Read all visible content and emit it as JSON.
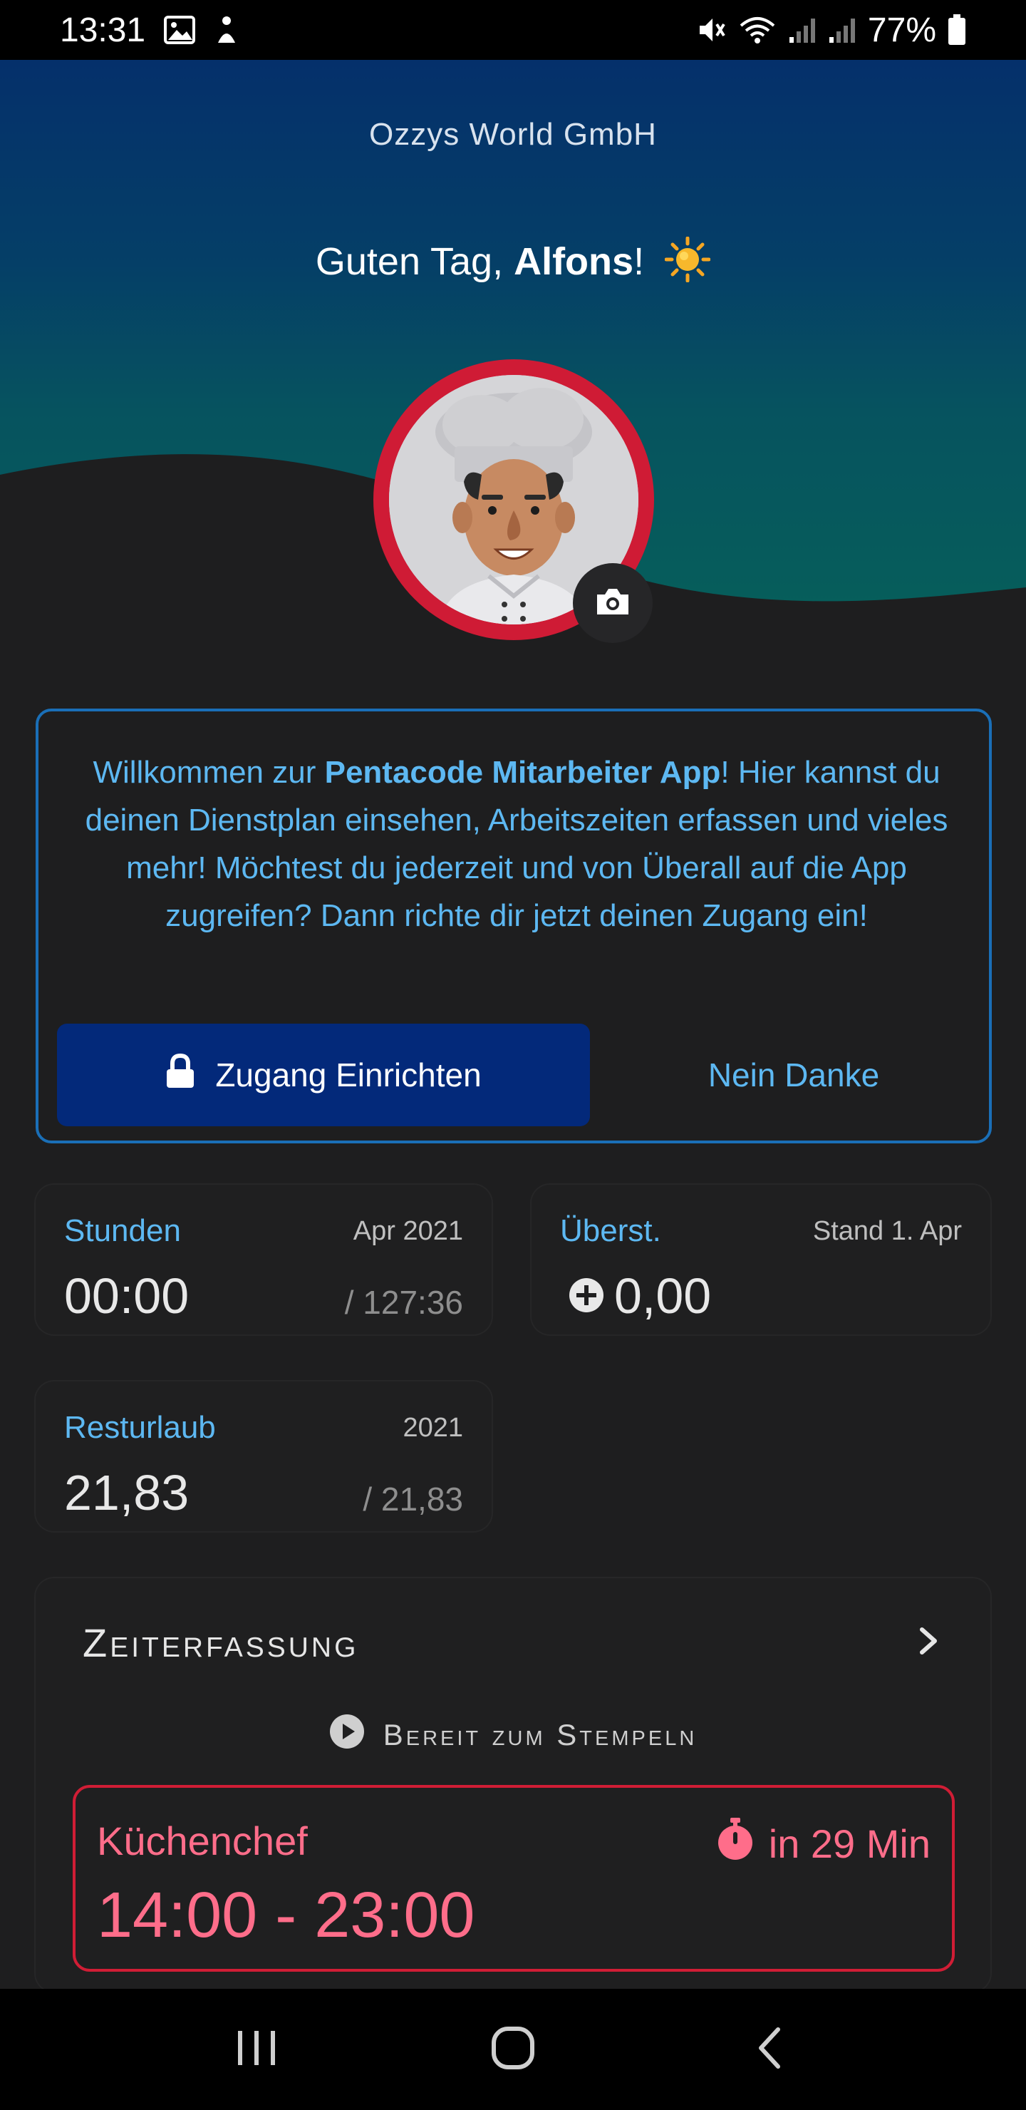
{
  "status_bar": {
    "time": "13:31",
    "battery": "77%",
    "icons": [
      "image-icon",
      "notification-icon",
      "mute-icon",
      "wifi-icon",
      "signal-icon",
      "signal-icon",
      "battery-icon"
    ]
  },
  "header": {
    "company": "Ozzys World GmbH",
    "greeting_prefix": "Guten Tag, ",
    "user_name": "Alfons",
    "greeting_suffix": "!",
    "greeting_icon": "sun-emoji",
    "avatar": "chef-avatar",
    "avatar_ring_color": "#cf1b35"
  },
  "welcome": {
    "text_1": "Willkommen zur ",
    "app_name": "Pentacode Mitarbeiter App",
    "text_2": "! Hier kannst du deinen Dienstplan einsehen, Arbeitszeiten erfassen und vieles mehr! Möchtest du jederzeit und von Überall auf die App zugreifen? Dann richte dir jetzt deinen Zugang ein!",
    "primary_button": "Zugang Einrichten",
    "secondary_button": "Nein Danke",
    "accent": "#5db8f2",
    "button_color": "#03297a"
  },
  "stats": {
    "hours": {
      "label": "Stunden",
      "period": "Apr 2021",
      "value": "00:00",
      "target": "/ 127:36"
    },
    "overtime": {
      "label": "Überst.",
      "period": "Stand 1. Apr",
      "value": "0,00"
    },
    "vacation": {
      "label": "Resturlaub",
      "period": "2021",
      "value": "21,83",
      "total": "/ 21,83"
    }
  },
  "time_tracking": {
    "title": "Zeiterfassung",
    "status": "Bereit zum Stempeln",
    "shift": {
      "role": "Küchenchef",
      "countdown": "in 29 Min",
      "time": "14:00 - 23:00",
      "color": "#ff6d8a",
      "border_color": "#d01d35"
    }
  },
  "nav": [
    "recent-apps",
    "home",
    "back"
  ]
}
